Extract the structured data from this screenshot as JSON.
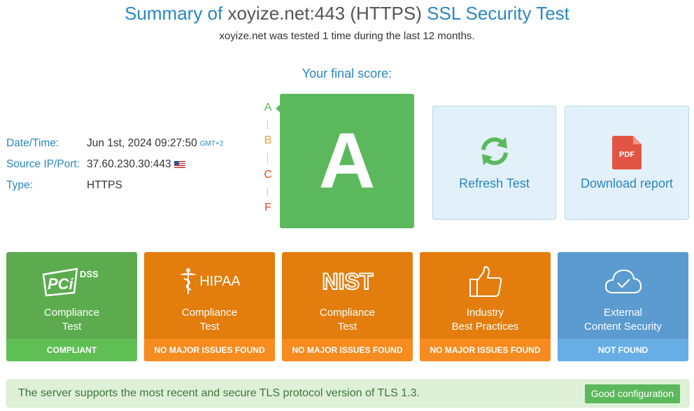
{
  "header": {
    "title_prefix": "Summary of ",
    "title_host": "xoyize.net:443 (HTTPS)",
    "title_suffix": " SSL Security Test",
    "subtitle": "xoyize.net was tested 1 time during the last 12 months."
  },
  "score": {
    "label": "Your final score:",
    "grade": "A",
    "scale": [
      "A",
      "B",
      "C",
      "F"
    ],
    "scale_colors": [
      "#5cb85c",
      "#f0a030",
      "#e04b2c",
      "#e04b2c"
    ]
  },
  "info": {
    "date_label": "Date/Time:",
    "date_value": "Jun 1st, 2024 09:27:50",
    "gmt": "GMT+2",
    "ip_label": "Source IP/Port:",
    "ip_value": "37.60.230.30:443",
    "type_label": "Type:",
    "type_value": "HTTPS"
  },
  "actions": {
    "refresh": "Refresh Test",
    "download": "Download report",
    "pdf_text": "PDF"
  },
  "cards": [
    {
      "logo": "PCi",
      "logo_sub": "DSS",
      "line1": "Compliance",
      "line2": "Test",
      "status": "COMPLIANT"
    },
    {
      "logo": "HIPAA",
      "line1": "Compliance",
      "line2": "Test",
      "status": "NO MAJOR ISSUES FOUND"
    },
    {
      "logo": "NIST",
      "line1": "Compliance",
      "line2": "Test",
      "status": "NO MAJOR ISSUES FOUND"
    },
    {
      "line1": "Industry",
      "line2": "Best Practices",
      "status": "NO MAJOR ISSUES FOUND"
    },
    {
      "line1": "External",
      "line2": "Content Security",
      "status": "NOT FOUND"
    }
  ],
  "banner": {
    "message": "The server supports the most recent and secure TLS protocol version of TLS 1.3.",
    "badge": "Good configuration"
  },
  "colors": {
    "accent": "#2a87c0",
    "grade_green": "#5cb85c",
    "orange": "#e37d0e",
    "blue": "#5b9bd0"
  }
}
